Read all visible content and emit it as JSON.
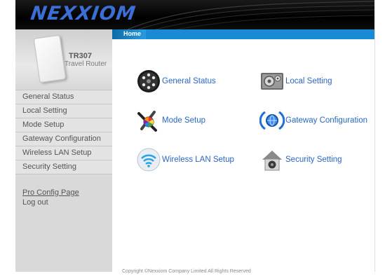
{
  "header": {
    "logo_text": "NEXXIOM"
  },
  "device": {
    "model": "TR307",
    "subtitle": "Travel Router"
  },
  "sidebar": {
    "items": [
      {
        "label": "General Status"
      },
      {
        "label": "Local Setting"
      },
      {
        "label": "Mode Setup"
      },
      {
        "label": "Gateway Configuration"
      },
      {
        "label": "Wireless LAN Setup"
      },
      {
        "label": "Security Setting"
      }
    ],
    "pro_config": "Pro Config Page",
    "logout": "Log out"
  },
  "breadcrumb": {
    "current": "Home"
  },
  "tiles": [
    {
      "label": "General Status",
      "icon": "dial-icon"
    },
    {
      "label": "Local Setting",
      "icon": "gear-screen-icon"
    },
    {
      "label": "Mode Setup",
      "icon": "tools-color-wheel-icon"
    },
    {
      "label": "Gateway Configuration",
      "icon": "gateway-globe-icon"
    },
    {
      "label": "Wireless LAN Setup",
      "icon": "wifi-icon"
    },
    {
      "label": "Security Setting",
      "icon": "house-security-icon"
    }
  ],
  "footer": {
    "text": "Copyright ©Nexxiom Company Limited All Rights Reserved"
  },
  "colors": {
    "link_blue": "#2a66c2",
    "bar_blue": "#1a8ad4",
    "sidebar_gray": "#d9d9d9"
  }
}
